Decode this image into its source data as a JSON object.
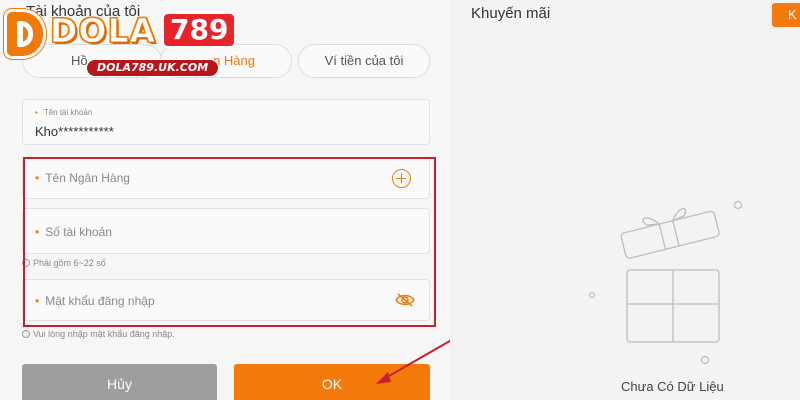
{
  "left": {
    "title": "Tài khoản của tôi",
    "logo": {
      "text": "DOLA",
      "number": "789",
      "domain": "DOLA789.UK.COM"
    },
    "tabs": [
      {
        "label": "Hồ"
      },
      {
        "label": "n Hàng"
      },
      {
        "label": "Ví tiền của tôi"
      }
    ],
    "account": {
      "label": "Tên tài khoản",
      "value": "Kho***********"
    },
    "bank_name": {
      "placeholder": "Tên Ngân Hàng"
    },
    "account_number": {
      "placeholder": "Số tài khoản",
      "hint": "Phải gồm 6~22 số"
    },
    "password": {
      "placeholder": "Mật khẩu đăng nhập",
      "hint": "Vui lòng nhập mật khẩu đăng nhập."
    },
    "buttons": {
      "cancel": "Hủy",
      "ok": "OK"
    }
  },
  "right": {
    "title": "Khuyến mãi",
    "corner_button": "K",
    "empty_text": "Chưa Có Dữ Liệu"
  },
  "colors": {
    "accent": "#f47a0c",
    "highlight_box": "#c8202a",
    "cancel_button": "#9e9e9e"
  },
  "icons": [
    "plus-circle-icon",
    "eye-slash-icon",
    "gift-box-icon",
    "arrow-icon"
  ]
}
